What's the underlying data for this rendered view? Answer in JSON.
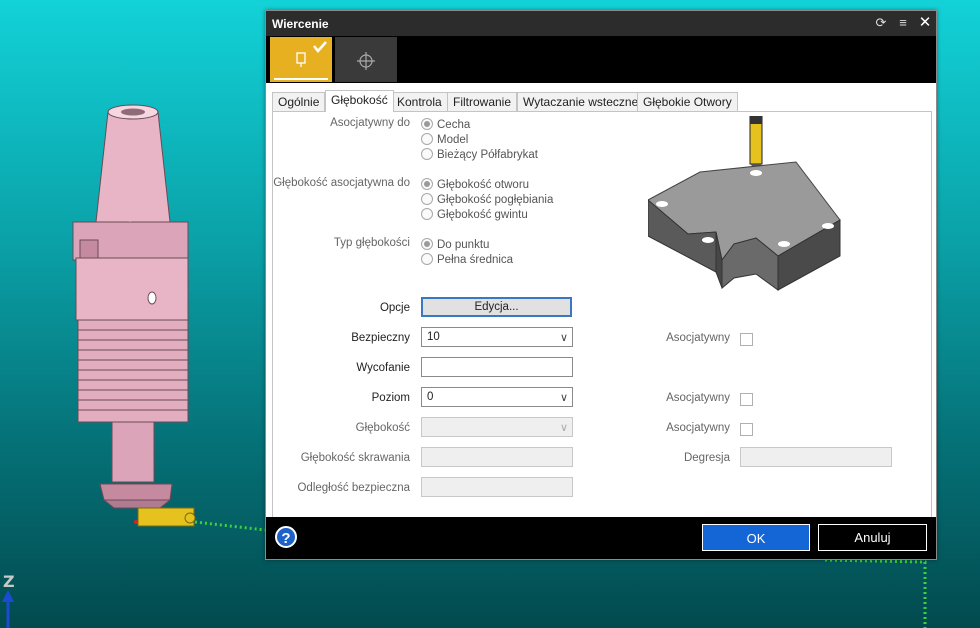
{
  "window": {
    "title": "Wiercenie"
  },
  "tabs": [
    "Ogólnie",
    "Głębokość",
    "Kontrola",
    "Filtrowanie",
    "Wytaczanie wsteczne",
    "Głębokie Otwory"
  ],
  "associative_to": {
    "label": "Asocjatywny do",
    "options": [
      "Cecha",
      "Model",
      "Bieżący Półfabrykat"
    ],
    "selected": "Cecha"
  },
  "depth_associative": {
    "label": "Głębokość asocjatywna do",
    "options": [
      "Głębokość otworu",
      "Głębokość pogłębiania",
      "Głębokość gwintu"
    ],
    "selected": "Głębokość otworu"
  },
  "depth_type": {
    "label": "Typ głębokości",
    "options": [
      "Do punktu",
      "Pełna średnica"
    ],
    "selected": "Do punktu"
  },
  "options_row": {
    "label": "Opcje",
    "button": "Edycja..."
  },
  "safe": {
    "label": "Bezpieczny",
    "value": "10",
    "assoc_label": "Asocjatywny"
  },
  "chamfer": {
    "label": "Wycofanie",
    "value": ""
  },
  "level": {
    "label": "Poziom",
    "value": "0",
    "assoc_label": "Asocjatywny"
  },
  "depth": {
    "label": "Głębokość",
    "value": "",
    "assoc_label": "Asocjatywny"
  },
  "cut_depth": {
    "label": "Głębokość skrawania",
    "value": ""
  },
  "safe_distance": {
    "label": "Odległość bezpieczna",
    "value": ""
  },
  "degression": {
    "label": "Degresja",
    "value": ""
  },
  "footer": {
    "help": "?",
    "ok": "OK",
    "cancel": "Anuluj"
  },
  "viewport": {
    "axis": "Z"
  },
  "colors": {
    "accent": "#1466d6",
    "tool_active": "#e6b021",
    "holder": "#e8b6c8",
    "path": "#3cd23c"
  }
}
